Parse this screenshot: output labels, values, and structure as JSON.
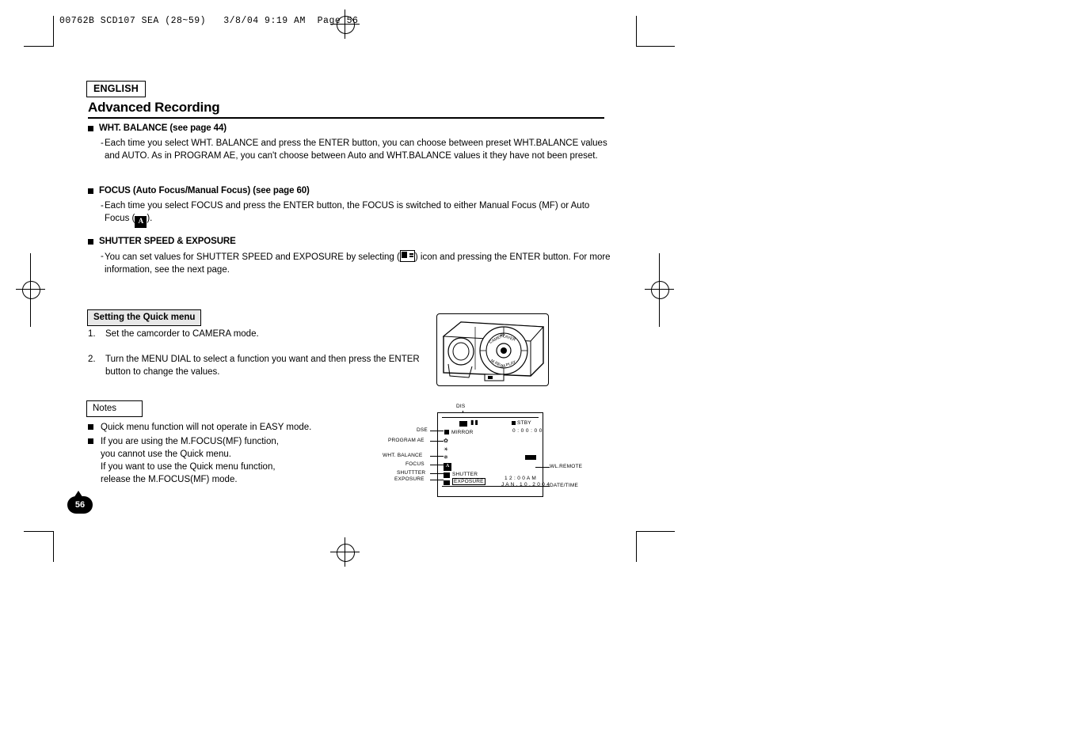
{
  "slug": "00762B SCD107 SEA (28~59)   3/8/04 9:19 AM  Page 56",
  "language_badge": "ENGLISH",
  "page_title": "Advanced Recording",
  "page_number": "56",
  "sections": [
    {
      "heading": "WHT. BALANCE (see page 44)",
      "dash": "-",
      "body": "Each time you select WHT. BALANCE and press the ENTER button, you can choose between preset WHT.BALANCE values and AUTO. As in PROGRAM AE, you can't choose between Auto and WHT.BALANCE values it they have not been preset."
    },
    {
      "heading": "FOCUS (Auto Focus/Manual Focus) (see page 60)",
      "dash": "-",
      "body_part1": "Each time you select FOCUS and press the ENTER button, the FOCUS is switched to either Manual Focus (MF) or Auto Focus (",
      "icon_label": "A",
      "body_part2": ")."
    },
    {
      "heading": "SHUTTER SPEED & EXPOSURE",
      "dash": "-",
      "body_part1": "You can set values for SHUTTER SPEED and EXPOSURE by selecting (",
      "body_part2": ") icon and pressing the ENTER button. For more information, see the next page."
    }
  ],
  "quick_menu": {
    "label": "Setting the Quick menu",
    "steps": [
      {
        "num": "1.",
        "text": "Set the camcorder to CAMERA mode."
      },
      {
        "num": "2.",
        "text": "Turn the MENU DIAL to select a function you want and then press the ENTER button to change the values."
      }
    ]
  },
  "notes": {
    "label": "Notes",
    "items": [
      "Quick menu function will not operate in EASY mode.",
      "If you are using the M.FOCUS(MF) function,\nyou cannot use the Quick menu.\nIf you want to use the Quick menu function,\nrelease the M.FOCUS(MF) mode."
    ]
  },
  "camcorder_dial": {
    "labels": [
      "CAMERA",
      "PLAYER",
      "M.REC",
      "M.PLAY"
    ]
  },
  "lcd_diagram": {
    "callouts_top": [
      "DIS"
    ],
    "callouts_left": [
      "DSE",
      "PROGRAM AE",
      "WHT. BALANCE",
      "FOCUS",
      "SHUTTTER",
      "EXPOSURE"
    ],
    "callouts_right": [
      "WL.REMOTE",
      "DATE/TIME"
    ],
    "screen_items": [
      "MIRROR",
      "STBY",
      "0 : 0 0 : 0 0",
      "SHUTTER",
      "EXPOSURE",
      "1 2 : 0 0 A M",
      "J A N . 1 0 . 2 0 0 4"
    ]
  }
}
